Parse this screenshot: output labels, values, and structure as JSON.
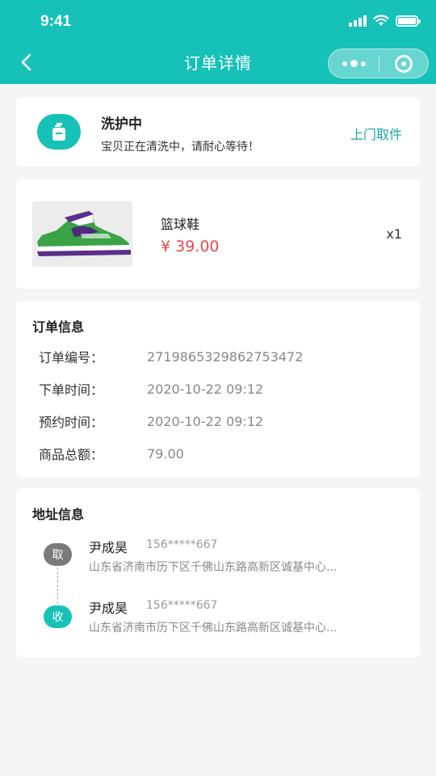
{
  "status_bar": {
    "time": "9:41"
  },
  "nav": {
    "title": "订单详情",
    "back_icon": "chevron-left-icon"
  },
  "colors": {
    "accent": "#16c1b8",
    "price": "#e84a4a",
    "link": "#16a9a3"
  },
  "order_status": {
    "title": "洗护中",
    "description": "宝贝正在清洗中，请耐心等待！",
    "action_label": "上门取件",
    "icon": "detergent-bottle-icon"
  },
  "product": {
    "name": "篮球鞋",
    "price": "¥ 39.00",
    "quantity": "x1",
    "image": "sneaker-image"
  },
  "order_info": {
    "title": "订单信息",
    "rows": [
      {
        "label": "订单编号：",
        "value": "2719865329862753472"
      },
      {
        "label": "下单时间：",
        "value": "2020-10-22 09:12"
      },
      {
        "label": "预约时间：",
        "value": "2020-10-22 09:12"
      },
      {
        "label": "商品总额：",
        "value": "79.00"
      }
    ]
  },
  "address_info": {
    "title": "地址信息",
    "entries": [
      {
        "badge": "取",
        "name": "尹成昊",
        "phone": "156*****667",
        "address": "山东省济南市历下区千佛山东路高新区诚基中心..."
      },
      {
        "badge": "收",
        "name": "尹成昊",
        "phone": "156*****667",
        "address": "山东省济南市历下区千佛山东路高新区诚基中心..."
      }
    ]
  }
}
